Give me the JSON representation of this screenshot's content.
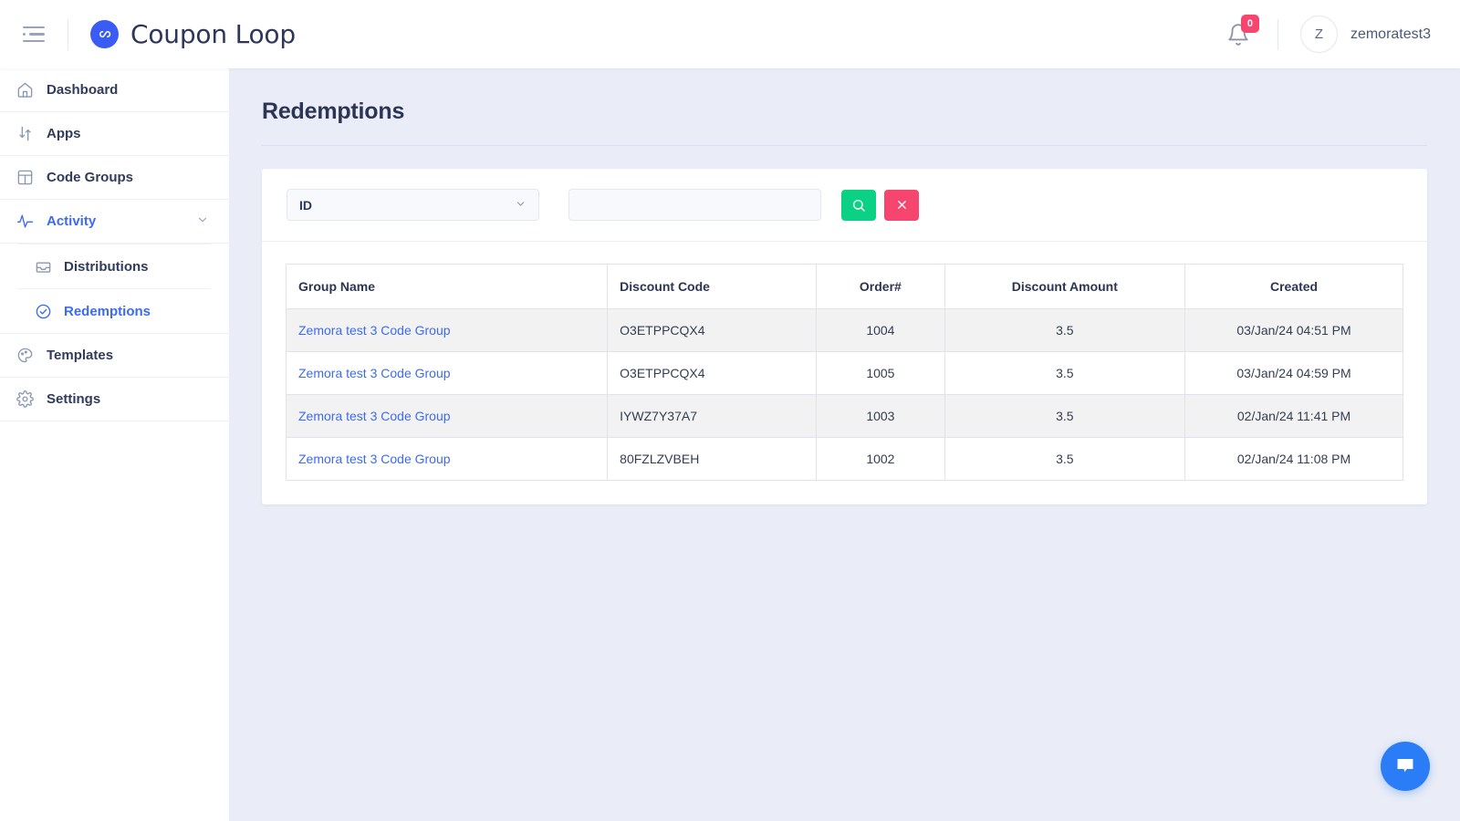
{
  "topbar": {
    "menu_icon": "hamburger-icon",
    "brand_name": "Coupon Loop",
    "brand_logo_icon": "infinity-loop-logo",
    "notification_icon": "bell-icon",
    "notification_count": "0",
    "avatar_initial": "Z",
    "user_name": "zemoratest3"
  },
  "sidebar": {
    "items": [
      {
        "label": "Dashboard",
        "icon": "home-icon",
        "active": false
      },
      {
        "label": "Apps",
        "icon": "apps-transfer-icon",
        "active": false
      },
      {
        "label": "Code Groups",
        "icon": "layout-grid-icon",
        "active": false
      },
      {
        "label": "Activity",
        "icon": "activity-pulse-icon",
        "active": true,
        "expanded": true,
        "chevron": "chevron-down-icon"
      },
      {
        "label": "Templates",
        "icon": "palette-icon",
        "active": false
      },
      {
        "label": "Settings",
        "icon": "gear-icon",
        "active": false
      }
    ],
    "sub_items": [
      {
        "label": "Distributions",
        "icon": "inbox-icon",
        "active": false
      },
      {
        "label": "Redemptions",
        "icon": "check-circle-icon",
        "active": true
      }
    ]
  },
  "main": {
    "page_title": "Redemptions",
    "filter": {
      "select_value": "ID",
      "select_chevron_icon": "chevron-down-icon",
      "search_value": "",
      "search_placeholder": "",
      "search_button_icon": "search-icon",
      "clear_button_icon": "close-x-icon"
    },
    "table": {
      "columns": [
        "Group Name",
        "Discount Code",
        "Order#",
        "Discount Amount",
        "Created"
      ],
      "rows": [
        {
          "group_name": "Zemora test 3 Code Group",
          "discount_code": "O3ETPPCQX4",
          "order": "1004",
          "amount": "3.5",
          "created": "03/Jan/24 04:51 PM"
        },
        {
          "group_name": "Zemora test 3 Code Group",
          "discount_code": "O3ETPPCQX4",
          "order": "1005",
          "amount": "3.5",
          "created": "03/Jan/24 04:59 PM"
        },
        {
          "group_name": "Zemora test 3 Code Group",
          "discount_code": "IYWZ7Y37A7",
          "order": "1003",
          "amount": "3.5",
          "created": "02/Jan/24 11:41 PM"
        },
        {
          "group_name": "Zemora test 3 Code Group",
          "discount_code": "80FZLZVBEH",
          "order": "1002",
          "amount": "3.5",
          "created": "02/Jan/24 11:08 PM"
        }
      ]
    }
  },
  "chat_widget": {
    "icon": "chat-bubble-icon"
  },
  "colors": {
    "brand_blue": "#3b5bf5",
    "link_blue": "#3d6af0",
    "accent_green": "#0bd184",
    "accent_pink": "#f6456e",
    "page_bg": "#eaedf7",
    "chat_blue": "#2a7cf7"
  }
}
